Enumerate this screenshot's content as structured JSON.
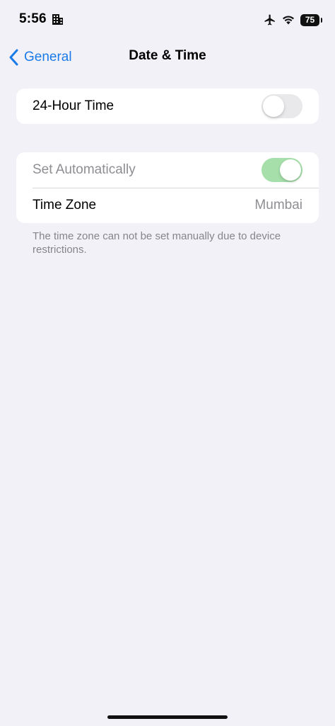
{
  "status_bar": {
    "time": "5:56",
    "battery_level": "75",
    "icons": [
      "building-icon",
      "airplane-icon",
      "wifi-icon",
      "battery-icon"
    ]
  },
  "nav": {
    "back_label": "General",
    "title": "Date & Time"
  },
  "group1": {
    "hour24_label": "24-Hour Time",
    "hour24_enabled": false
  },
  "group2": {
    "set_auto_label": "Set Automatically",
    "set_auto_enabled": true,
    "set_auto_disabled": true,
    "timezone_label": "Time Zone",
    "timezone_value": "Mumbai"
  },
  "footer_note": "The time zone can not be set manually due to device restrictions.",
  "colors": {
    "background": "#f2f1f7",
    "accent": "#1a7be8",
    "toggle_on_disabled": "#a6dfaa",
    "toggle_off": "#e9e9eb",
    "secondary_text": "#8e8e93"
  }
}
